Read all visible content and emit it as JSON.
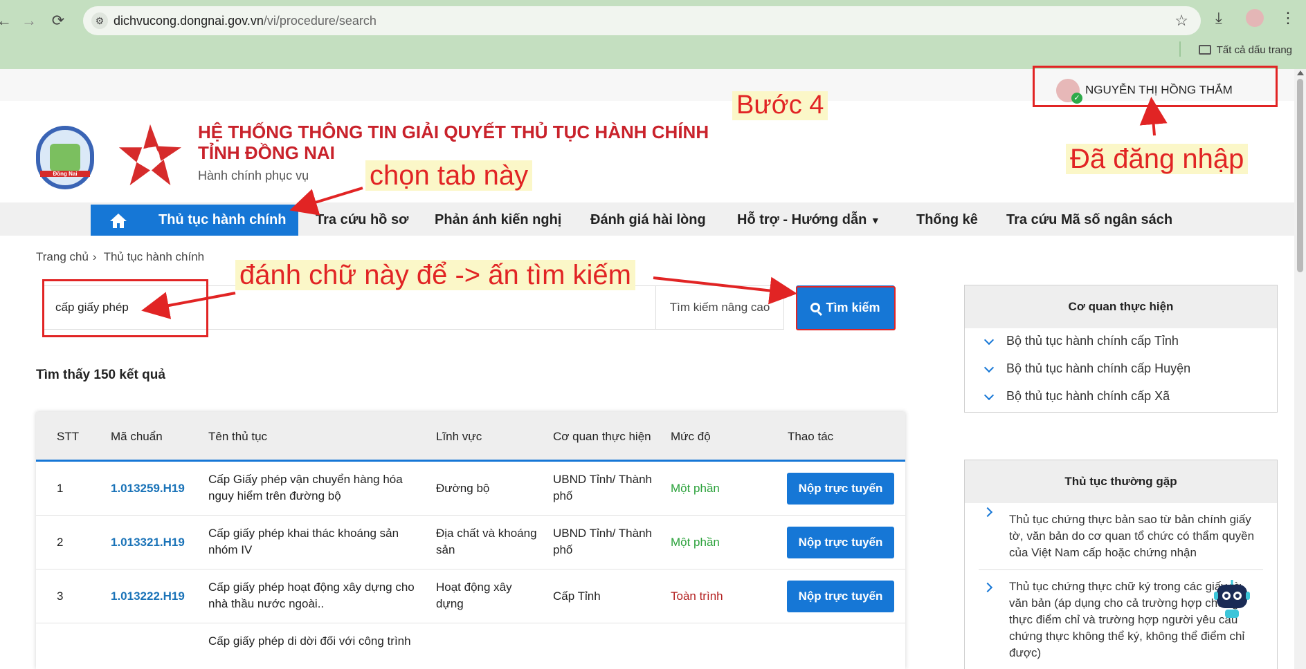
{
  "browser": {
    "url_host": "dichvucong.dongnai.gov.vn",
    "url_path": "/vi/procedure/search",
    "bookmarks_label": "Tất cả dấu trang"
  },
  "header": {
    "user_name": "NGUYỄN THỊ HỒNG THẮM",
    "title_line1": "HỆ THỐNG THÔNG TIN GIẢI QUYẾT THỦ TỤC HÀNH CHÍNH",
    "title_line2": "TỈNH ĐỒNG NAI",
    "subtitle": "Hành chính phục vụ",
    "logo_text": "Đồng Nai"
  },
  "menu": {
    "items": [
      "Thủ tục hành chính",
      "Tra cứu hồ sơ",
      "Phản ánh kiến nghị",
      "Đánh giá hài lòng",
      "Hỗ trợ - Hướng dẫn",
      "Thống kê",
      "Tra cứu Mã số ngân sách"
    ]
  },
  "breadcrumb": {
    "home": "Trang chủ",
    "current": "Thủ tục hành chính"
  },
  "search": {
    "value": "cấp giấy phép",
    "advanced_label": "Tìm kiếm nâng cao",
    "button_label": "Tìm kiếm"
  },
  "results": {
    "count_text": "Tìm thấy 150 kết quả",
    "columns": [
      "STT",
      "Mã chuẩn",
      "Tên thủ tục",
      "Lĩnh vực",
      "Cơ quan thực hiện",
      "Mức độ",
      "Thao tác"
    ],
    "apply_label": "Nộp trực tuyến",
    "rows": [
      {
        "stt": "1",
        "code": "1.013259.H19",
        "name": "Cấp Giấy phép vận chuyển hàng hóa nguy hiểm trên đường bộ",
        "field": "Đường bộ",
        "agency": "UBND Tỉnh/ Thành phố",
        "level": "Một phần"
      },
      {
        "stt": "2",
        "code": "1.013321.H19",
        "name": "Cấp giấy phép khai thác khoáng sản nhóm IV",
        "field": "Địa chất và khoáng sản",
        "agency": "UBND Tỉnh/ Thành phố",
        "level": "Một phần"
      },
      {
        "stt": "3",
        "code": "1.013222.H19",
        "name": "Cấp giấy phép hoạt động xây dựng cho nhà thầu nước ngoài..",
        "field": "Hoạt động xây dựng",
        "agency": "Cấp Tỉnh",
        "level": "Toàn trình"
      },
      {
        "stt": "",
        "code": "",
        "name": "Cấp giấy phép di dời đối với công trình",
        "field": "",
        "agency": "",
        "level": ""
      }
    ]
  },
  "sidebar": {
    "agency_panel": {
      "title": "Cơ quan thực hiện",
      "items": [
        "Bộ thủ tục hành chính cấp Tỉnh",
        "Bộ thủ tục hành chính cấp Huyện",
        "Bộ thủ tục hành chính cấp Xã"
      ]
    },
    "faq_panel": {
      "title": "Thủ tục thường gặp",
      "items": [
        "Thủ tục chứng thực bản sao từ bản chính giấy tờ, văn bản do cơ quan tổ chức có thẩm quyền của Việt Nam cấp hoặc chứng nhận",
        "Thủ tục chứng thực chữ ký trong các giấy tờ, văn bản (áp dụng cho cả trường hợp chứng thực điểm chỉ và trường hợp người yêu cầu chứng thực không thể ký, không thể điểm chỉ được)"
      ]
    }
  },
  "annotations": {
    "step": "Bước 4",
    "logged_in": "Đã đăng nhập",
    "choose_tab": "chọn tab này",
    "type_text": "đánh chữ này để -> ấn tìm kiếm"
  },
  "colors": {
    "primary": "#1677d6",
    "brand_red": "#c9222b",
    "annotation": "#e12424",
    "chrome": "#c4dfc0"
  }
}
